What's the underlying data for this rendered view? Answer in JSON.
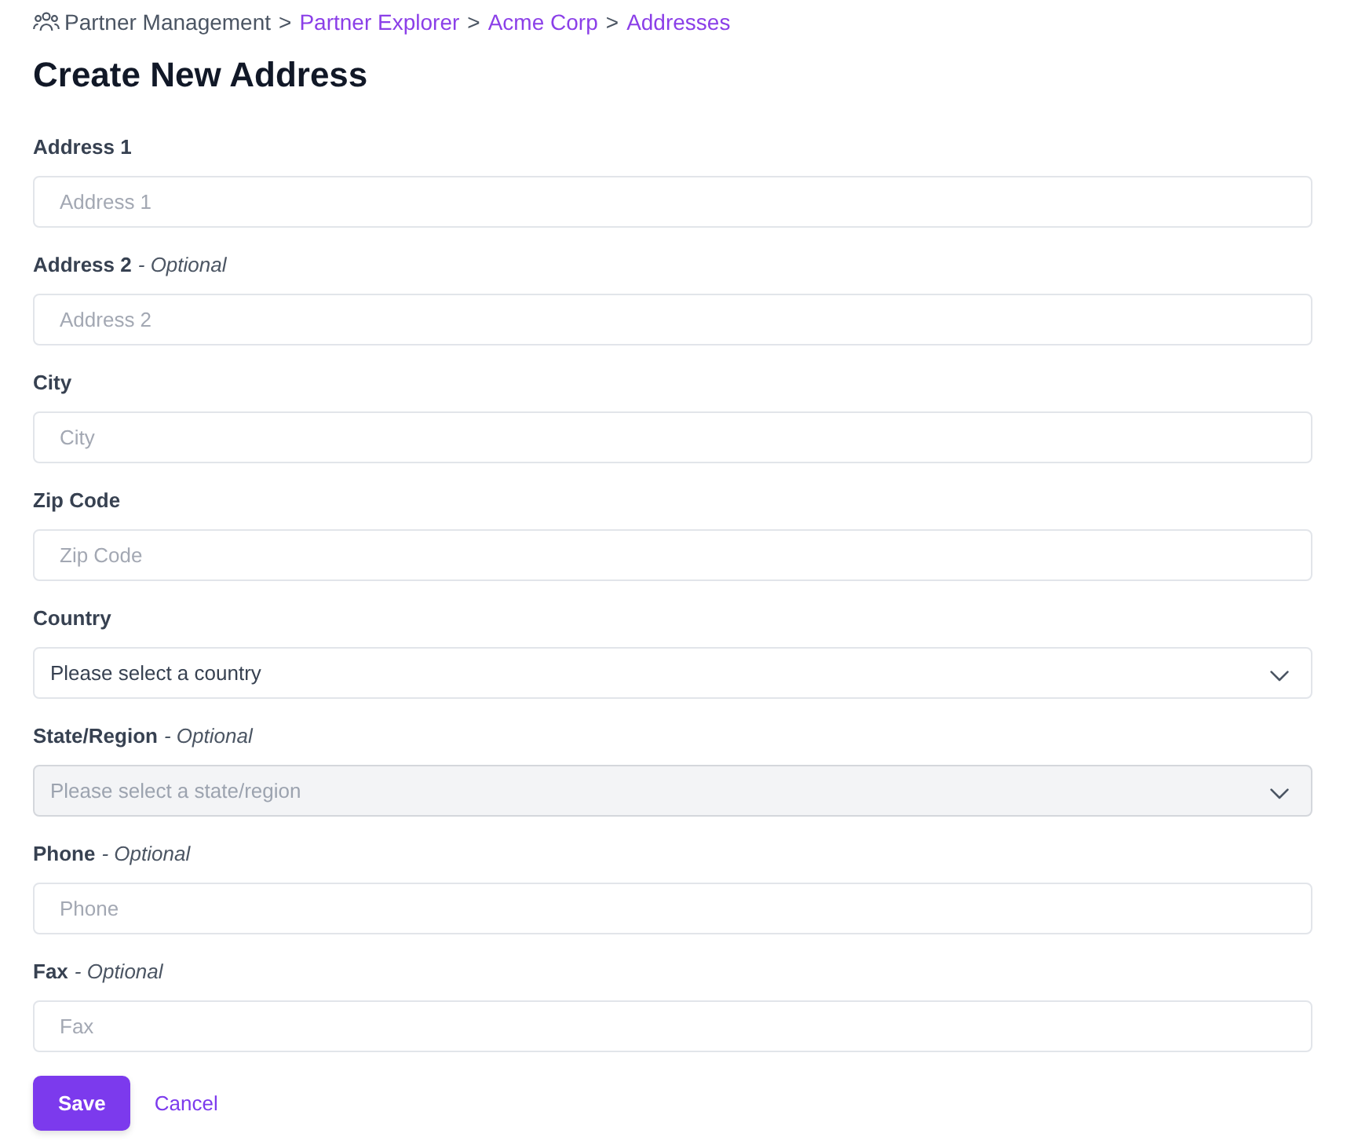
{
  "breadcrumb": [
    {
      "kind": "root",
      "label": "Partner Management"
    },
    {
      "kind": "separator",
      "label": ">"
    },
    {
      "kind": "link",
      "label": "Partner Explorer"
    },
    {
      "kind": "separator",
      "label": ">"
    },
    {
      "kind": "link",
      "label": "Acme Corp"
    },
    {
      "kind": "separator",
      "label": ">"
    },
    {
      "kind": "link",
      "label": "Addresses"
    }
  ],
  "title": "Create New Address",
  "fields": [
    {
      "kind": "text",
      "label": "Address 1",
      "placeholder": "Address 1"
    },
    {
      "kind": "text",
      "label": "Address 2",
      "note": "- Optional",
      "placeholder": "Address 2"
    },
    {
      "kind": "text",
      "label": "City",
      "placeholder": "City"
    },
    {
      "kind": "text",
      "label": "Zip Code",
      "placeholder": "Zip Code"
    },
    {
      "kind": "select",
      "label": "Country",
      "value": "Please select a country",
      "disabled": false
    },
    {
      "kind": "select",
      "label": "State/Region",
      "note": "- Optional",
      "value": "Please select a state/region",
      "disabled": true
    },
    {
      "kind": "text",
      "label": "Phone",
      "note": "- Optional",
      "placeholder": "Phone"
    },
    {
      "kind": "text",
      "label": "Fax",
      "note": "- Optional",
      "placeholder": "Fax"
    }
  ],
  "actions": [
    {
      "kind": "primary",
      "label": "Save"
    },
    {
      "kind": "link",
      "label": "Cancel"
    }
  ]
}
